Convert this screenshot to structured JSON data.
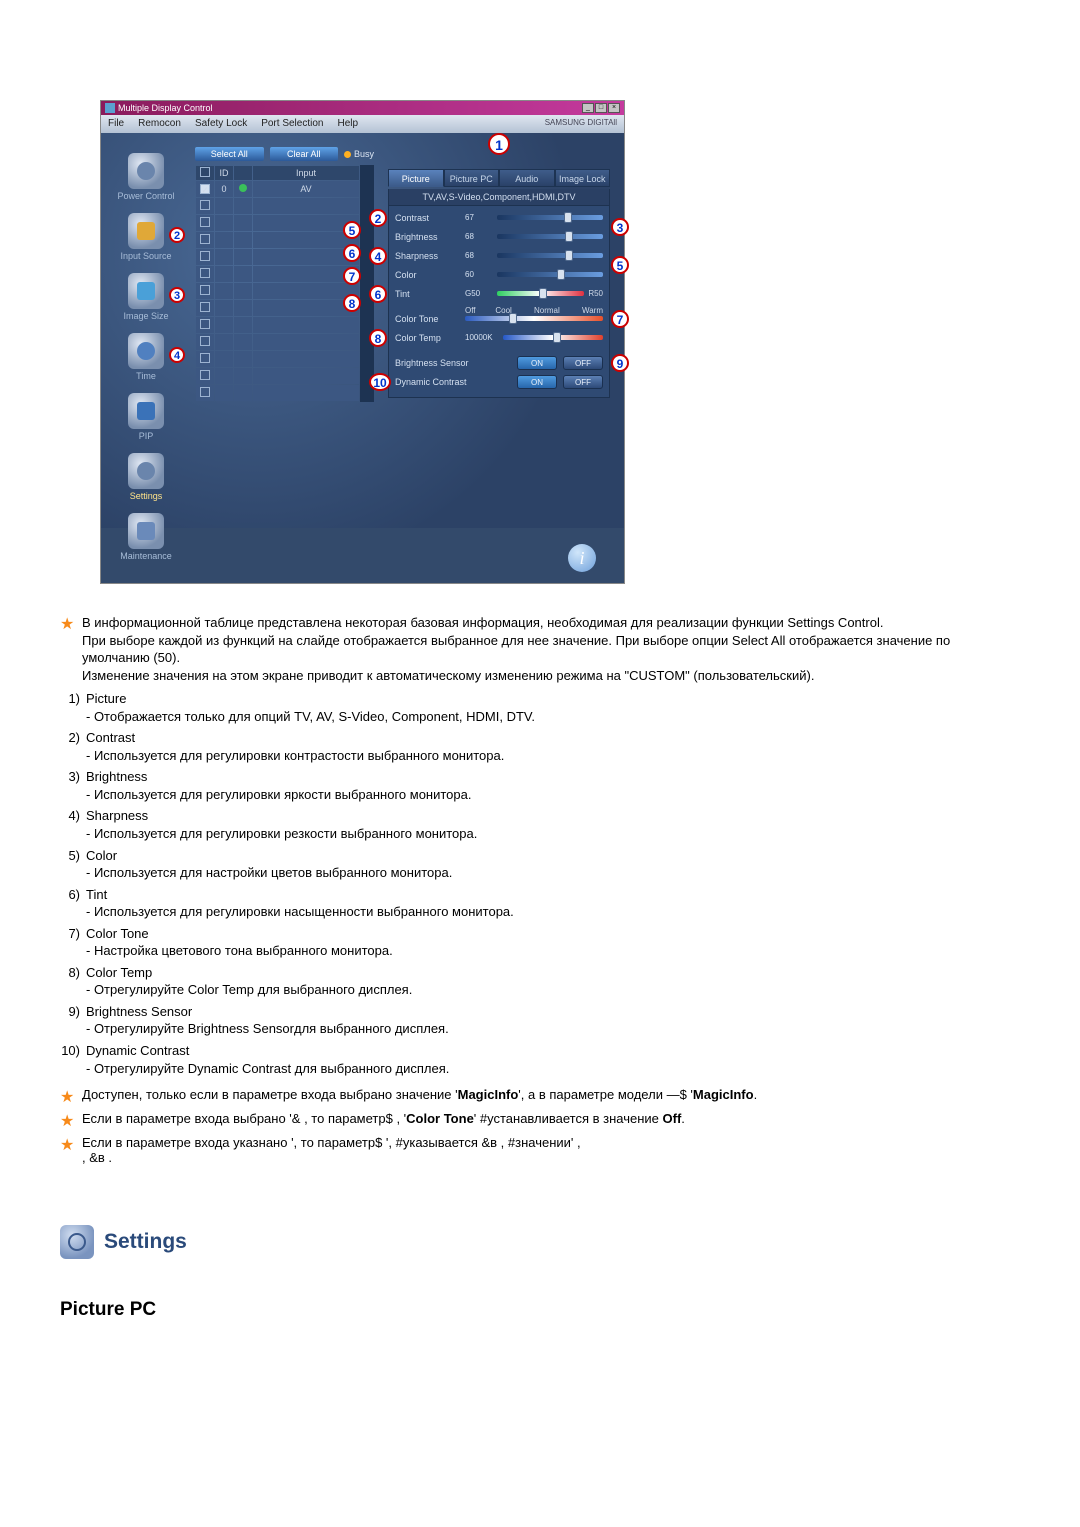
{
  "app": {
    "title": "Multiple Display Control",
    "brand": "SAMSUNG DIGITAll",
    "menu": [
      "File",
      "Remocon",
      "Safety Lock",
      "Port Selection",
      "Help"
    ]
  },
  "sidebar": {
    "items": [
      {
        "label": "Power Control",
        "badge": ""
      },
      {
        "label": "Input Source",
        "badge": "2"
      },
      {
        "label": "Image Size",
        "badge": "3"
      },
      {
        "label": "Time",
        "badge": "4"
      },
      {
        "label": "PIP",
        "badge": ""
      },
      {
        "label": "Settings",
        "badge": ""
      },
      {
        "label": "Maintenance",
        "badge": ""
      }
    ]
  },
  "center": {
    "select_all": "Select All",
    "clear_all": "Clear All",
    "busy": "Busy",
    "head_input": "Input",
    "head_id": "ID",
    "av": "AV",
    "id0": "0"
  },
  "panel": {
    "tabs": [
      "Picture",
      "Picture PC",
      "Audio",
      "Image Lock"
    ],
    "subhead": "TV,AV,S-Video,Component,HDMI,DTV",
    "rows": {
      "contrast": {
        "label": "Contrast",
        "val": "67"
      },
      "brightness": {
        "label": "Brightness",
        "val": "68"
      },
      "sharpness": {
        "label": "Sharpness",
        "val": "68"
      },
      "color": {
        "label": "Color",
        "val": "60"
      },
      "tint": {
        "label": "Tint",
        "val": "G50",
        "right": "R50"
      },
      "colortone": {
        "label": "Color Tone",
        "opts": [
          "Off",
          "Cool",
          "Normal",
          "Warm"
        ]
      },
      "colortemp": {
        "label": "Color Temp",
        "val": "10000K"
      },
      "bsensor": {
        "label": "Brightness Sensor",
        "on": "ON",
        "off": "OFF"
      },
      "dcontrast": {
        "label": "Dynamic Contrast",
        "on": "ON",
        "off": "OFF"
      }
    },
    "big1": "1"
  },
  "badges_center": [
    "5",
    "6",
    "7",
    "8"
  ],
  "badges_right": [
    "2",
    "3",
    "4",
    "5",
    "6",
    "7",
    "8",
    "9",
    "10"
  ],
  "doc": {
    "intro": [
      "В информационной таблице представлена некоторая базовая информация, необходимая для реализации функции Settings Control.",
      "При выборе каждой из функций на слайде отображается выбранное для нее значение. При выборе опции Select All отображается значение по умолчанию (50).",
      "Изменение значения на этом экране приводит к автоматическому изменению режима на \"CUSTOM\" (пользовательский)."
    ],
    "items": [
      {
        "n": "1)",
        "t": "Picture",
        "d": "- Отображается только для опций TV, AV, S-Video, Component, HDMI, DTV."
      },
      {
        "n": "2)",
        "t": "Contrast",
        "d": "- Используется для регулировки контрастости выбранного монитора."
      },
      {
        "n": "3)",
        "t": "Brightness",
        "d": "- Используется для регулировки яркости выбранного монитора."
      },
      {
        "n": "4)",
        "t": "Sharpness",
        "d": "- Используется для регулировки резкости выбранного монитора."
      },
      {
        "n": "5)",
        "t": "Color",
        "d": "- Используется для настройки цветов выбранного монитора."
      },
      {
        "n": "6)",
        "t": "Tint",
        "d": "- Используется для регулировки насыщенности выбранного монитора."
      },
      {
        "n": "7)",
        "t": "Color Tone",
        "d": "- Настройка цветового тона выбранного монитора."
      },
      {
        "n": "8)",
        "t": "Color Temp",
        "d": "- Отрегулируйте Color Temp для выбранного дисплея."
      },
      {
        "n": "9)",
        "t": "Brightness Sensor",
        "d": "- Отрегулируйте Brightness Sensorдля выбранного дисплея."
      },
      {
        "n": "10)",
        "t": "Dynamic Contrast",
        "d": "- Отрегулируйте Dynamic Contrast для выбранного дисплея."
      }
    ],
    "notes": [
      {
        "pre": "Доступен, только если в параметре входа выбрано значение '",
        "b": "MagicInfo",
        "mid": "', а в параметре модели —$ '",
        "b2": "MagicInfo",
        "post": "."
      },
      {
        "pre": "Если в параметре входа выбрано '",
        "mid": "& , то параметр$ , '",
        "b": "Color Tone",
        "mid2": "' #устанавливается в значение ",
        "b2": "Off",
        "post": "."
      },
      {
        "pre": "Если в параметре входа указнано ',",
        "mid": " то параметр$ ',",
        "mid2": " #указывается &в ,",
        "mid3": " #значении' ,",
        "post2": ", &в .",
        "post": ""
      }
    ]
  },
  "settings": {
    "title": "Settings"
  },
  "picpc": "Picture PC"
}
